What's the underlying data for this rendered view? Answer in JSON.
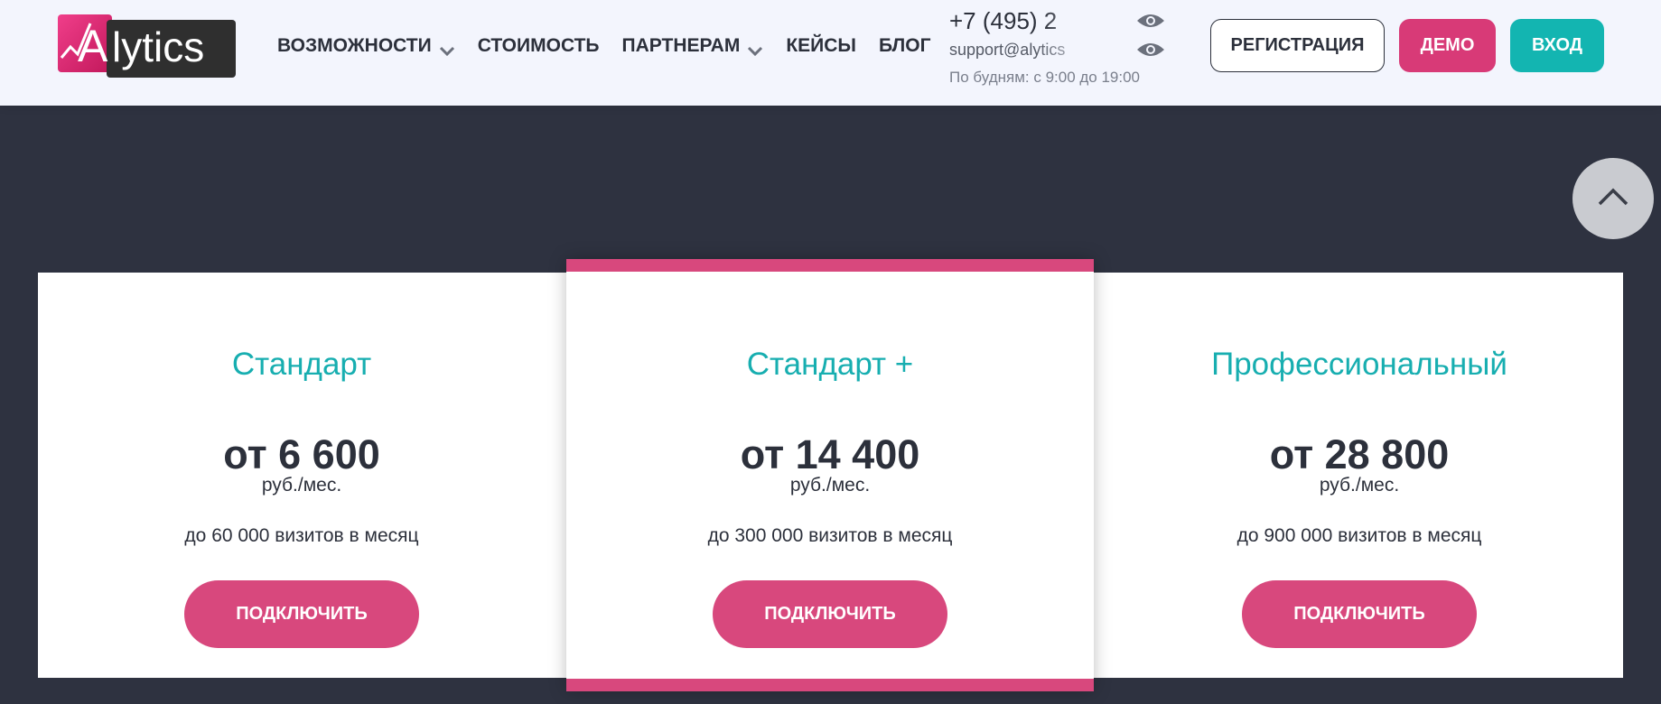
{
  "logo": {
    "text": "Alytics"
  },
  "nav": {
    "items": [
      {
        "label": "ВОЗМОЖНОСТИ",
        "has_dropdown": true
      },
      {
        "label": "СТОИМОСТЬ",
        "has_dropdown": false
      },
      {
        "label": "ПАРТНЕРАМ",
        "has_dropdown": true
      },
      {
        "label": "КЕЙСЫ",
        "has_dropdown": false
      },
      {
        "label": "БЛОГ",
        "has_dropdown": false
      }
    ]
  },
  "contacts": {
    "phone": "+7 (495) 2",
    "email": "support@alytics",
    "hours": "По будням: с 9:00 до 19:00"
  },
  "buttons": {
    "register": "РЕГИСТРАЦИЯ",
    "demo": "ДЕМО",
    "login": "ВХОД"
  },
  "plans": [
    {
      "name": "Стандарт",
      "price": "от 6 600",
      "unit": "руб./мес.",
      "visits": "до 60 000 визитов в месяц",
      "button": "ПОДКЛЮЧИТЬ"
    },
    {
      "name": "Стандарт +",
      "price": "от 14 400",
      "unit": "руб./мес.",
      "visits": "до 300 000 визитов в месяц",
      "button": "ПОДКЛЮЧИТЬ"
    },
    {
      "name": "Профессиональный",
      "price": "от 28 800",
      "unit": "руб./мес.",
      "visits": "до 900 000 визитов в месяц",
      "button": "ПОДКЛЮЧИТЬ"
    }
  ],
  "colors": {
    "brand_pink": "#d83a77",
    "brand_teal": "#13b5b1",
    "dark_bg": "#2e3240",
    "header_bg": "#f3f5fd"
  },
  "icons": {
    "nav_dropdown": "chevron-down-icon",
    "contact_toggle": "eye-icon",
    "scroll_top": "chevron-up-icon"
  }
}
